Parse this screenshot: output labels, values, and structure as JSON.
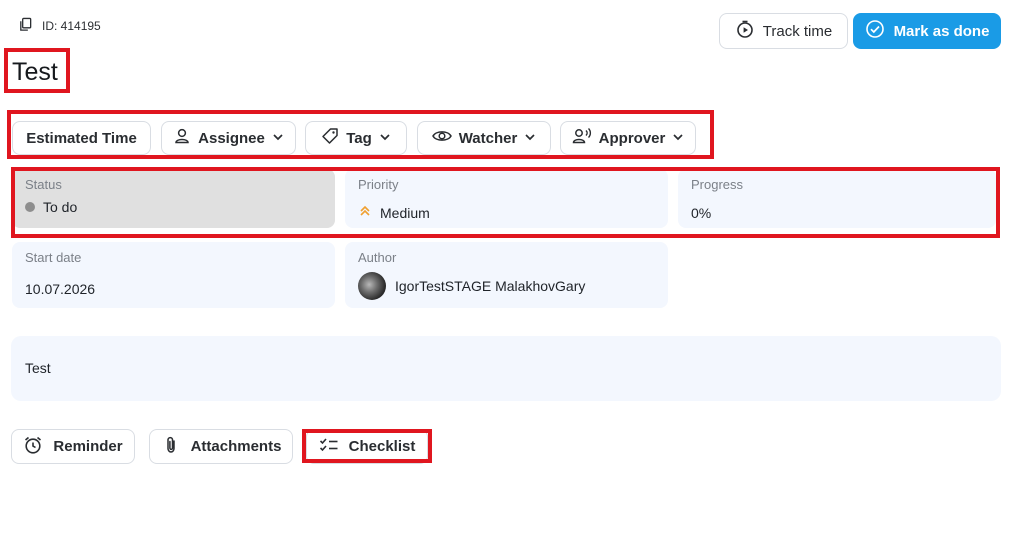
{
  "task": {
    "id_label": "ID: 414195",
    "title": "Test",
    "description": "Test"
  },
  "header": {
    "track_time_label": "Track time",
    "mark_done_label": "Mark as done"
  },
  "chips": {
    "estimated_time": "Estimated Time",
    "assignee": "Assignee",
    "tag": "Tag",
    "watcher": "Watcher",
    "approver": "Approver"
  },
  "fields": {
    "status": {
      "label": "Status",
      "value": "To do"
    },
    "priority": {
      "label": "Priority",
      "value": "Medium"
    },
    "progress": {
      "label": "Progress",
      "value": "0%"
    },
    "start_date": {
      "label": "Start date",
      "value": "10.07.2026"
    },
    "author": {
      "label": "Author",
      "value": "IgorTestSTAGE MalakhovGary"
    }
  },
  "actions": {
    "reminder": "Reminder",
    "attachments": "Attachments",
    "checklist": "Checklist"
  },
  "colors": {
    "primary": "#1a9be6",
    "highlight": "#e0161f",
    "priority_medium": "#f0a030"
  }
}
